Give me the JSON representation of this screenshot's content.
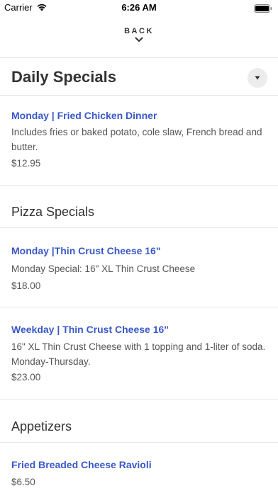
{
  "status_bar": {
    "carrier": "Carrier",
    "time": "6:26 AM"
  },
  "nav": {
    "back_label": "BACK"
  },
  "sections": [
    {
      "title": "Daily Specials",
      "items": [
        {
          "name": "Monday | Fried Chicken Dinner",
          "description": "Includes fries or baked potato, cole slaw, French bread and butter.",
          "price": "$12.95"
        }
      ]
    },
    {
      "title": "Pizza Specials",
      "items": [
        {
          "name": "Monday |Thin Crust Cheese 16\"",
          "description": "Monday Special: 16\" XL Thin Crust Cheese",
          "price": "$18.00"
        },
        {
          "name": "Weekday | Thin Crust Cheese  16\"",
          "description": "16\" XL Thin Crust Cheese with 1 topping and 1-liter of soda. Monday-Thursday.",
          "price": "$23.00"
        }
      ]
    },
    {
      "title": "Appetizers",
      "items": [
        {
          "name": "Fried Breaded Cheese Ravioli",
          "price": "$6.50"
        }
      ]
    }
  ],
  "colors": {
    "link": "#3a59c7",
    "text": "#333333",
    "muted": "#555555",
    "divider": "#e6e6e6"
  },
  "icons": {
    "toggle": "triangle-down-icon",
    "back": "chevron-down-icon",
    "signal": "wifi-icon",
    "battery": "battery-icon"
  }
}
